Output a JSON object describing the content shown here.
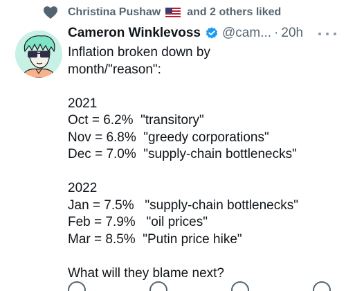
{
  "social_context": {
    "liker": "Christina Pushaw",
    "flag_icon": "us-flag-icon",
    "others_text": "and 2 others liked",
    "accent_color": "#536471"
  },
  "tweet": {
    "author_name": "Cameron Winklevoss",
    "verified_color": "#1d9bf0",
    "handle": "@cam...",
    "separator": "·",
    "timestamp": "20h",
    "lines": [
      "Inflation broken down by",
      "month/\"reason\":",
      "",
      "2021",
      "Oct = 6.2%  \"transitory\"",
      "Nov = 6.8%  \"greedy corporations\"",
      "Dec = 7.0%  \"supply-chain bottlenecks\"",
      "",
      "2022",
      "Jan = 7.5%   \"supply-chain bottlenecks\"",
      "Feb = 7.9%   \"oil prices\"",
      "Mar = 8.5%  \"Putin price hike\"",
      "",
      "What will they blame next?"
    ]
  }
}
